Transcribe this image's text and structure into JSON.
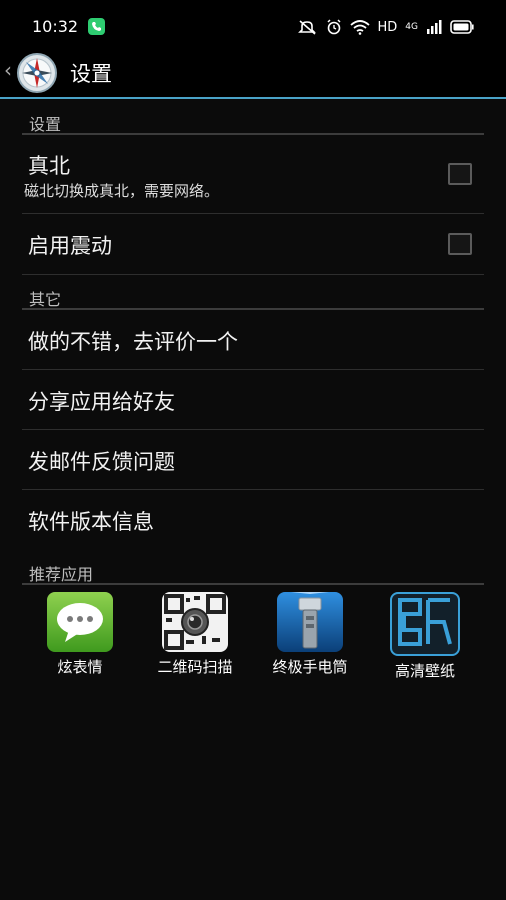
{
  "status": {
    "time": "10:32",
    "hd": "HD",
    "network": "4G"
  },
  "header": {
    "title": "设置"
  },
  "sections": {
    "settings": "设置",
    "others": "其它",
    "recommend": "推荐应用"
  },
  "settings": {
    "true_north": {
      "label": "真北",
      "summary": "磁北切换成真北，需要网络。"
    },
    "vibration": {
      "label": "启用震动"
    }
  },
  "others": {
    "rate": "做的不错，去评价一个",
    "share": "分享应用给好友",
    "feedback": "发邮件反馈问题",
    "version": "软件版本信息"
  },
  "apps": [
    {
      "name": "炫表情",
      "icon": "chat-bubble-icon"
    },
    {
      "name": "二维码扫描",
      "icon": "qr-code-icon"
    },
    {
      "name": "终极手电筒",
      "icon": "flashlight-icon"
    },
    {
      "name": "高清壁纸",
      "icon": "wallpaper-icon"
    }
  ],
  "colors": {
    "accent": "#4aa3c8",
    "background": "#0b0b0b"
  }
}
